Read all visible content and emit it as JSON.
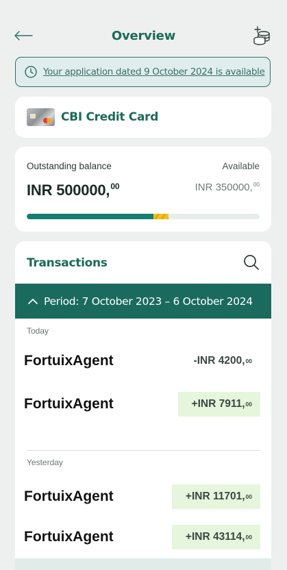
{
  "header": {
    "title": "Overview",
    "back_icon": "arrow-left-icon",
    "coins_icon": "coins-add-icon"
  },
  "notice": {
    "icon": "clock-icon",
    "text": "Your application dated 9 October 2024 is available"
  },
  "card": {
    "name": "CBI Credit Card",
    "thumbnail_icon": "credit-card-icon"
  },
  "balance": {
    "outstanding_label": "Outstanding balance",
    "outstanding_amount": "INR 500000,",
    "outstanding_decimals": "00",
    "available_label": "Available",
    "available_amount": "INR 350000,",
    "available_decimals": "00",
    "used_fraction": 0.55,
    "colors": {
      "used": "#147f72",
      "marker": "#f2c21c",
      "track": "#e6eeec"
    }
  },
  "transactions": {
    "title": "Transactions",
    "search_icon": "search-icon",
    "period_icon": "chevron-up-icon",
    "period": "Period: 7 October 2023 – 6 October 2024",
    "groups": [
      {
        "day": "Today",
        "items": [
          {
            "name": "FortuixAgent",
            "amount": "-INR 4200,",
            "decimals": "00",
            "type": "debit"
          },
          {
            "name": "FortuixAgent",
            "amount": "+INR 7911,",
            "decimals": "00",
            "type": "credit"
          }
        ]
      },
      {
        "day": "Yesterday",
        "items": [
          {
            "name": "FortuixAgent",
            "amount": "+INR 11701,",
            "decimals": "00",
            "type": "credit"
          },
          {
            "name": "FortuixAgent",
            "amount": "+INR 43114,",
            "decimals": "00",
            "type": "credit"
          }
        ]
      }
    ]
  },
  "colors": {
    "brand": "#1b6b57",
    "period_bar": "#1a6a5d",
    "credit_bg": "#e6f6dd",
    "page_bg": "#eef0ef"
  }
}
